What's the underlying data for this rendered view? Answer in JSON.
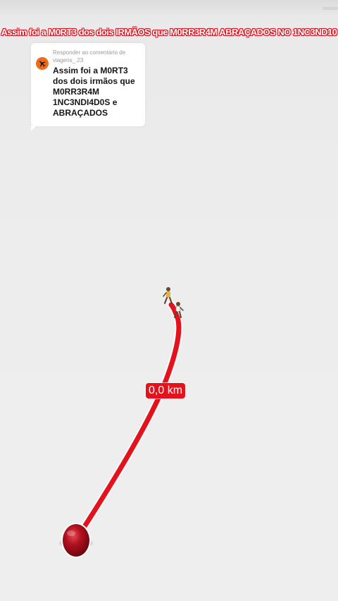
{
  "caption": {
    "text": "Assim foi a M0RT3 dos dois IRMÃOS que M0RR3R4M ABRAÇADOS NO 1NC3ND10"
  },
  "reply": {
    "label": "Responder ao comentário de viagens_.23",
    "text": "Assim foi a M0RT3 dos dois irmãos que M0RR3R4M 1NC3NDI4D0S e ABRAÇADOS",
    "avatar_icon": "airplane-icon",
    "avatar_color": "#f06a1a"
  },
  "map": {
    "distance_label": "0,0 km",
    "route_color": "#e3131d",
    "start_marker_icon": "red-pin-marker-icon",
    "end_marker_icon": "walking-figures-icon"
  }
}
